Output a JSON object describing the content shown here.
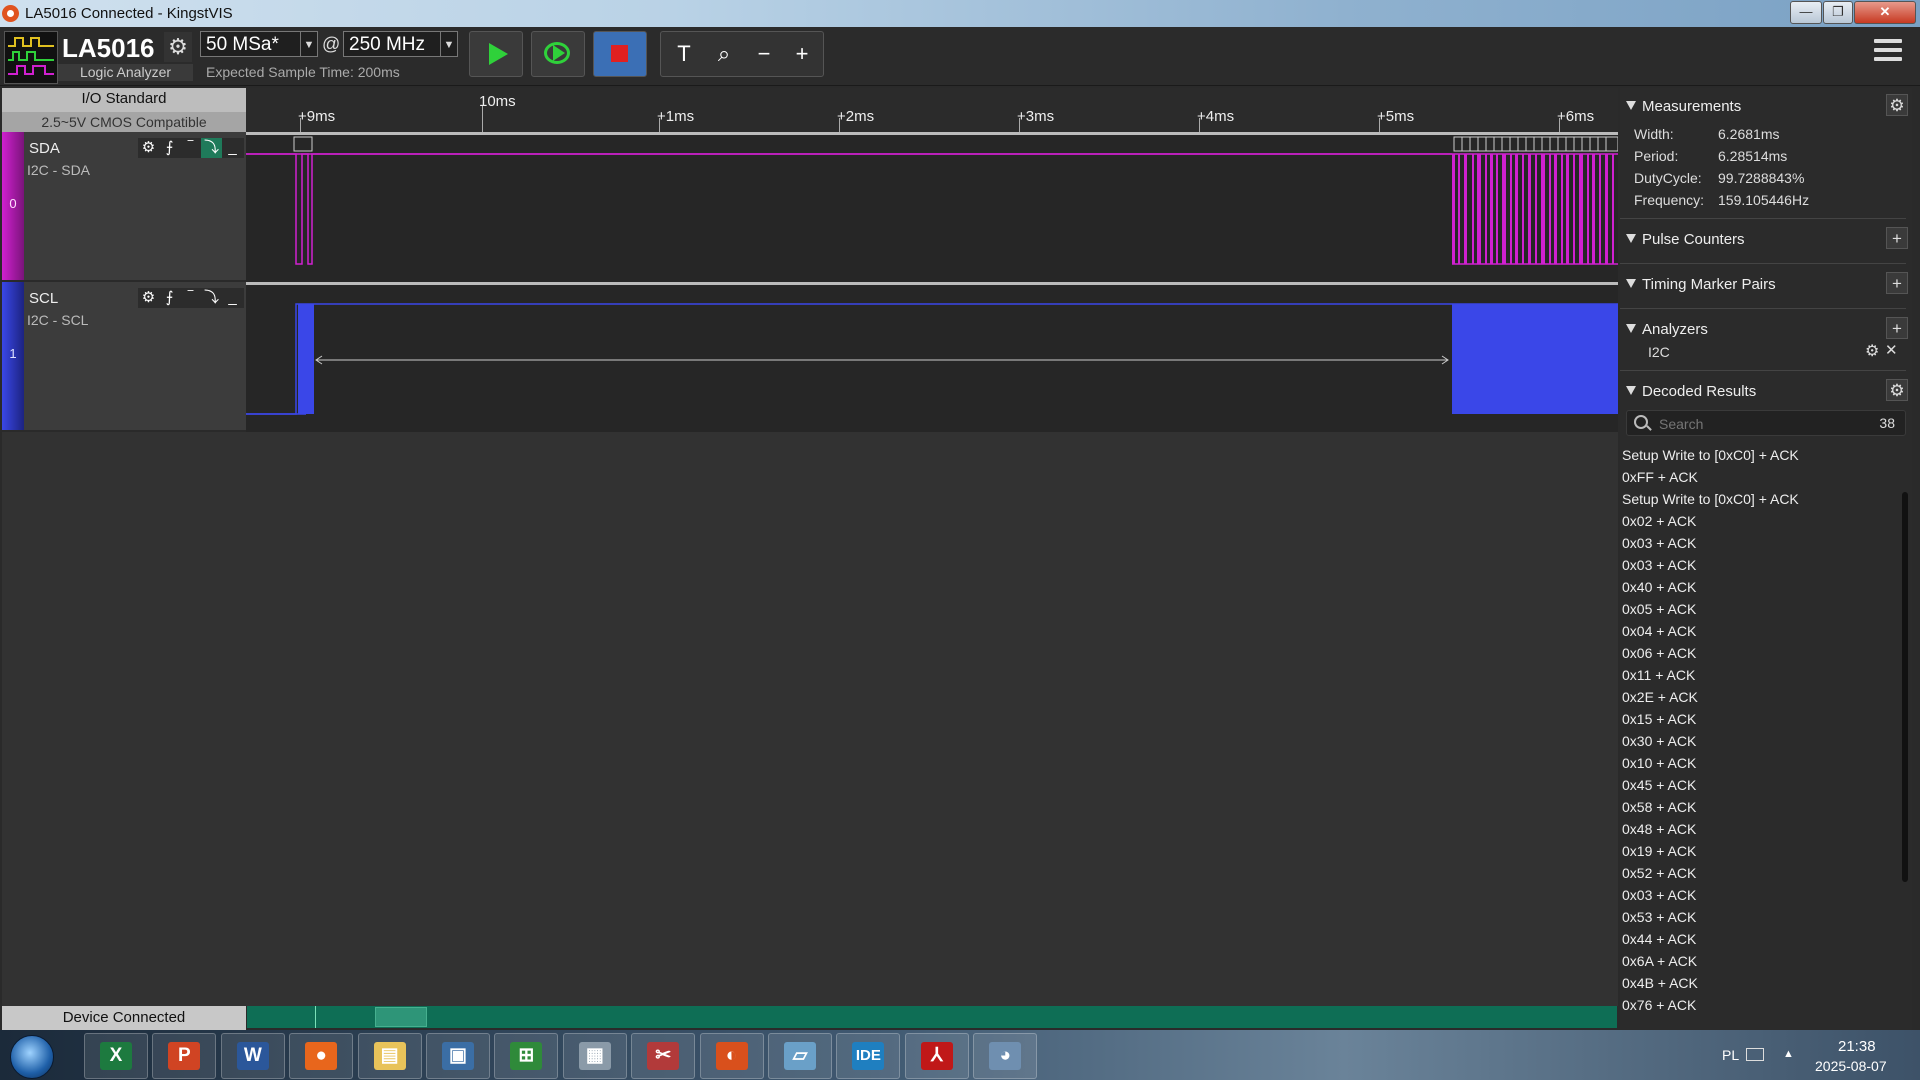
{
  "window": {
    "title": "LA5016 Connected - KingstVIS",
    "minimize": "—",
    "maximize": "❐",
    "close": "✕"
  },
  "toolbar": {
    "device_name": "LA5016",
    "device_subtitle": "Logic Analyzer",
    "sample_rate": "50 MSa*",
    "at": "@",
    "threshold_freq": "250 MHz",
    "expected_time": "Expected Sample Time: 200ms",
    "zoom_tools": [
      "T",
      "⌕",
      "−",
      "+"
    ]
  },
  "io_standard": {
    "title": "I/O Standard",
    "value": "2.5~5V CMOS Compatible"
  },
  "channels": [
    {
      "index": "0",
      "name": "SDA",
      "analyzer_label": "I2C - SDA",
      "color": "#d020d0"
    },
    {
      "index": "1",
      "name": "SCL",
      "analyzer_label": "I2C - SCL",
      "color": "#3a47e8"
    }
  ],
  "channel_tools": [
    "⚙",
    "⨍",
    "‾",
    "⤵",
    "_"
  ],
  "ruler": {
    "top_label": "10ms",
    "ticks": [
      "+9ms",
      "+1ms",
      "+2ms",
      "+3ms",
      "+4ms",
      "+5ms",
      "+6ms"
    ]
  },
  "status": {
    "left": "Device Connected"
  },
  "measurements": {
    "title": "Measurements",
    "rows": [
      {
        "key": "Width:",
        "value": "6.2681ms"
      },
      {
        "key": "Period:",
        "value": "6.28514ms"
      },
      {
        "key": "DutyCycle:",
        "value": "99.7288843%"
      },
      {
        "key": "Frequency:",
        "value": "159.105446Hz"
      }
    ]
  },
  "sections": {
    "pulse_counters": "Pulse Counters",
    "timing_marker_pairs": "Timing Marker Pairs",
    "analyzers": "Analyzers",
    "analyzer_item": "I2C",
    "decoded_results": "Decoded Results"
  },
  "decoded": {
    "search_placeholder": "Search",
    "count": "38",
    "results": [
      "Setup Write to [0xC0] + ACK",
      "0xFF + ACK",
      "Setup Write to [0xC0] + ACK",
      "0x02 + ACK",
      "0x03 + ACK",
      "0x03 + ACK",
      "0x40 + ACK",
      "0x05 + ACK",
      "0x04 + ACK",
      "0x06 + ACK",
      "0x11 + ACK",
      "0x2E + ACK",
      "0x15 + ACK",
      "0x30 + ACK",
      "0x10 + ACK",
      "0x45 + ACK",
      "0x58 + ACK",
      "0x48 + ACK",
      "0x19 + ACK",
      "0x52 + ACK",
      "0x03 + ACK",
      "0x53 + ACK",
      "0x44 + ACK",
      "0x6A + ACK",
      "0x4B + ACK",
      "0x76 + ACK"
    ]
  },
  "taskbar": {
    "apps": [
      {
        "name": "excel",
        "glyph": "X",
        "color": "#1d7a3f"
      },
      {
        "name": "powerpoint",
        "glyph": "P",
        "color": "#d04423"
      },
      {
        "name": "word",
        "glyph": "W",
        "color": "#2b579a"
      },
      {
        "name": "firefox",
        "glyph": "●",
        "color": "#e8661c"
      },
      {
        "name": "explorer",
        "glyph": "▤",
        "color": "#e8c35a"
      },
      {
        "name": "photos",
        "glyph": "▣",
        "color": "#3b6ea5"
      },
      {
        "name": "network",
        "glyph": "⊞",
        "color": "#2f8a3a"
      },
      {
        "name": "calculator",
        "glyph": "▦",
        "color": "#8a9aa8"
      },
      {
        "name": "paint",
        "glyph": "✂",
        "color": "#b23a3a"
      },
      {
        "name": "kingstvis",
        "glyph": "◐",
        "color": "#d9501c"
      },
      {
        "name": "notes",
        "glyph": "▱",
        "color": "#6aa0c8"
      },
      {
        "name": "arduino-ide",
        "glyph": "IDE",
        "color": "#1f7fc0"
      },
      {
        "name": "acrobat",
        "glyph": "⅄",
        "color": "#c01818"
      },
      {
        "name": "palette",
        "glyph": "◕",
        "color": "#6f8fb0"
      }
    ],
    "language": "PL",
    "time": "21:38",
    "date": "2025-08-07"
  }
}
